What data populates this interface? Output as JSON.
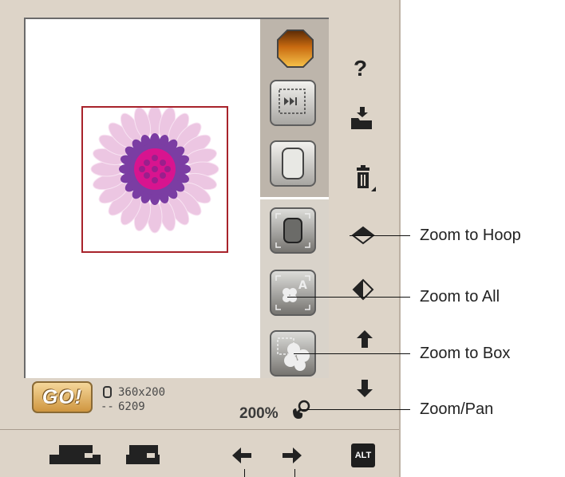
{
  "toolbar": {
    "help_glyph": "?",
    "alt_label": "ALT",
    "icons": [
      "help-icon",
      "open-file-icon",
      "delete-icon",
      "zoom-to-hoop-icon",
      "zoom-to-all-icon",
      "arrow-up-icon",
      "arrow-down-icon"
    ]
  },
  "status": {
    "go_label": "GO!",
    "hoop_size": "360x200",
    "stitch_prefix": "--",
    "stitch_count": "6209",
    "zoom_level": "200%"
  },
  "callouts": {
    "zoom_to_hoop": "Zoom to Hoop",
    "zoom_to_all": "Zoom to All",
    "zoom_to_box": "Zoom to Box",
    "zoom_pan": "Zoom/Pan"
  },
  "colors": {
    "frame": "#ddd4c8",
    "hoop_border": "#a8232b",
    "go_button": "#e0ab55",
    "petal_outer": "#ecc6e2",
    "petal_inner": "#7b3da3",
    "center": "#d8148f"
  }
}
